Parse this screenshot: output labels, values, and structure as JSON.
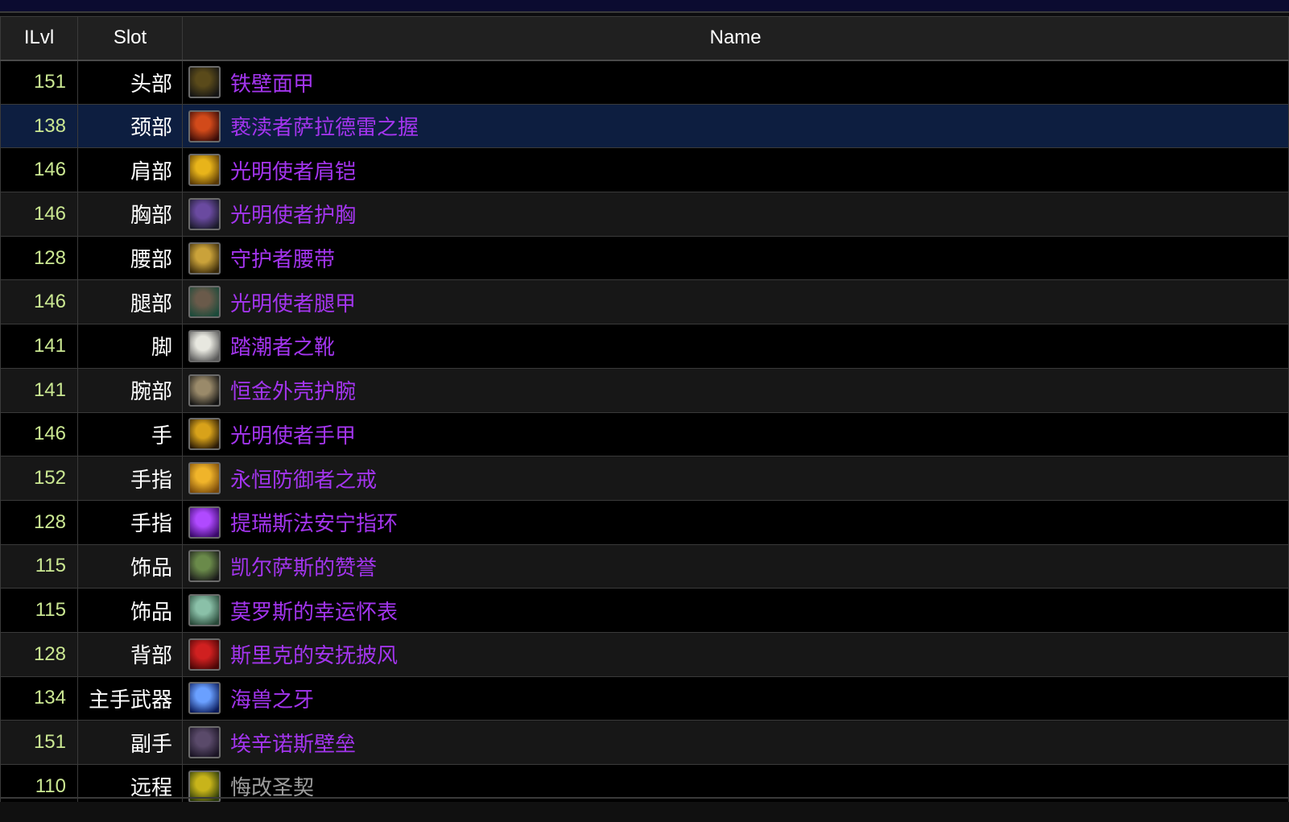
{
  "headers": {
    "ilvl": "ILvl",
    "slot": "Slot",
    "name": "Name"
  },
  "colors": {
    "epic": "#a335ee",
    "poor": "#9d9d9d",
    "ilvl": "#cbe892",
    "selected_row": "#0d1e40"
  },
  "selected_index": 1,
  "items": [
    {
      "ilvl": "151",
      "slot": "头部",
      "name": "铁壁面甲",
      "quality": "epic",
      "icon": "helm-icon",
      "icon_colors": [
        "#5a4a1a",
        "#141414"
      ]
    },
    {
      "ilvl": "138",
      "slot": "颈部",
      "name": "亵渎者萨拉德雷之握",
      "quality": "epic",
      "icon": "necklace-icon",
      "icon_colors": [
        "#d24a1a",
        "#3a0c08"
      ]
    },
    {
      "ilvl": "146",
      "slot": "肩部",
      "name": "光明使者肩铠",
      "quality": "epic",
      "icon": "shoulder-icon",
      "icon_colors": [
        "#e8b41a",
        "#5a3a06"
      ]
    },
    {
      "ilvl": "146",
      "slot": "胸部",
      "name": "光明使者护胸",
      "quality": "epic",
      "icon": "chest-icon",
      "icon_colors": [
        "#6a4aa0",
        "#1a1a2a"
      ]
    },
    {
      "ilvl": "128",
      "slot": "腰部",
      "name": "守护者腰带",
      "quality": "epic",
      "icon": "belt-icon",
      "icon_colors": [
        "#caa23a",
        "#3a2a0a"
      ]
    },
    {
      "ilvl": "146",
      "slot": "腿部",
      "name": "光明使者腿甲",
      "quality": "epic",
      "icon": "legs-icon",
      "icon_colors": [
        "#6a5a4a",
        "#1a4a3a"
      ]
    },
    {
      "ilvl": "141",
      "slot": "脚",
      "name": "踏潮者之靴",
      "quality": "epic",
      "icon": "boots-icon",
      "icon_colors": [
        "#e8e8e0",
        "#5a5a5a"
      ]
    },
    {
      "ilvl": "141",
      "slot": "腕部",
      "name": "恒金外壳护腕",
      "quality": "epic",
      "icon": "bracers-icon",
      "icon_colors": [
        "#9a8a6a",
        "#141414"
      ]
    },
    {
      "ilvl": "146",
      "slot": "手",
      "name": "光明使者手甲",
      "quality": "epic",
      "icon": "gloves-icon",
      "icon_colors": [
        "#d8a21a",
        "#2a1a06"
      ]
    },
    {
      "ilvl": "152",
      "slot": "手指",
      "name": "永恒防御者之戒",
      "quality": "epic",
      "icon": "ring-icon",
      "icon_colors": [
        "#f0b42a",
        "#7a4a0a"
      ]
    },
    {
      "ilvl": "128",
      "slot": "手指",
      "name": "提瑞斯法安宁指环",
      "quality": "epic",
      "icon": "ring-icon",
      "icon_colors": [
        "#b04aff",
        "#3a0a6a"
      ]
    },
    {
      "ilvl": "115",
      "slot": "饰品",
      "name": "凯尔萨斯的赞誉",
      "quality": "epic",
      "icon": "trinket-icon",
      "icon_colors": [
        "#6a8a4a",
        "#1a1a1a"
      ]
    },
    {
      "ilvl": "115",
      "slot": "饰品",
      "name": "莫罗斯的幸运怀表",
      "quality": "epic",
      "icon": "pocket-watch-icon",
      "icon_colors": [
        "#8ac0a8",
        "#2a4a3a"
      ]
    },
    {
      "ilvl": "128",
      "slot": "背部",
      "name": "斯里克的安抚披风",
      "quality": "epic",
      "icon": "cloak-icon",
      "icon_colors": [
        "#d02020",
        "#4a0606"
      ]
    },
    {
      "ilvl": "134",
      "slot": "主手武器",
      "name": "海兽之牙",
      "quality": "epic",
      "icon": "sword-icon",
      "icon_colors": [
        "#6aa0ff",
        "#0a1a5a"
      ]
    },
    {
      "ilvl": "151",
      "slot": "副手",
      "name": "埃辛诺斯壁垒",
      "quality": "epic",
      "icon": "shield-icon",
      "icon_colors": [
        "#5a4a6a",
        "#1a1424"
      ]
    },
    {
      "ilvl": "110",
      "slot": "远程",
      "name": "悔改圣契",
      "quality": "poor",
      "icon": "libram-icon",
      "icon_colors": [
        "#c8b41a",
        "#2a3a0a"
      ]
    }
  ]
}
